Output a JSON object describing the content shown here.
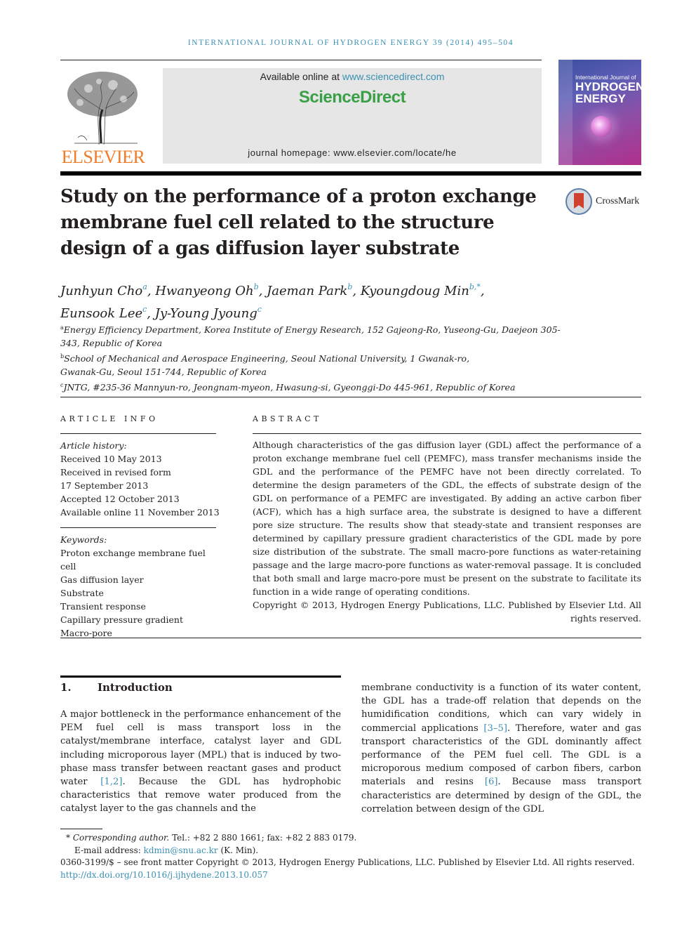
{
  "running_header": "INTERNATIONAL JOURNAL OF HYDROGEN ENERGY 39 (2014) 495–504",
  "publisher": {
    "logo_word": "ELSEVIER",
    "logo_icon": "elsevier-tree-icon"
  },
  "sciencedirect_box": {
    "available_prefix": "Available online at ",
    "available_link": "www.sciencedirect.com",
    "brand": "ScienceDirect",
    "homepage": "journal homepage: www.elsevier.com/locate/he"
  },
  "cover": {
    "line1": "International Journal of",
    "line2": "HYDROGEN",
    "line3": "ENERGY"
  },
  "crossmark": {
    "label": "CrossMark",
    "icon": "crossmark-icon"
  },
  "article": {
    "title": "Study on the performance of a proton exchange membrane fuel cell related to the structure design of a gas diffusion layer substrate",
    "authors": [
      {
        "name": "Junhyun Cho",
        "sup": "a",
        "sep": ", "
      },
      {
        "name": "Hwanyeong Oh",
        "sup": "b",
        "sep": ", "
      },
      {
        "name": "Jaeman Park",
        "sup": "b",
        "sep": ", "
      },
      {
        "name": "Kyoungdoug Min",
        "sup": "b,*",
        "sep": ","
      },
      {
        "name": "Eunsook Lee",
        "sup": "c",
        "sep": ", "
      },
      {
        "name": "Jy-Young Jyoung",
        "sup": "c",
        "sep": ""
      }
    ],
    "affiliations": [
      {
        "sup": "a",
        "text": "Energy Efficiency Department, Korea Institute of Energy Research, 152 Gajeong-Ro, Yuseong-Gu, Daejeon 305-343, Republic of Korea"
      },
      {
        "sup": "b",
        "text": "School of Mechanical and Aerospace Engineering, Seoul National University, 1 Gwanak-ro, Gwanak-Gu, Seoul 151-744, Republic of Korea"
      },
      {
        "sup": "c",
        "text": "JNTG, #235-36 Mannyun-ro, Jeongnam-myeon, Hwasung-si, Gyeonggi-Do 445-961, Republic of Korea"
      }
    ]
  },
  "article_info": {
    "heading": "ARTICLE INFO",
    "history_label": "Article history:",
    "history": [
      "Received 10 May 2013",
      "Received in revised form",
      "17 September 2013",
      "Accepted 12 October 2013",
      "Available online 11 November 2013"
    ],
    "keywords_label": "Keywords:",
    "keywords": [
      "Proton exchange membrane fuel cell",
      "Gas diffusion layer",
      "Substrate",
      "Transient response",
      "Capillary pressure gradient",
      "Macro-pore"
    ]
  },
  "abstract": {
    "heading": "ABSTRACT",
    "text": "Although characteristics of the gas diffusion layer (GDL) affect the performance of a proton exchange membrane fuel cell (PEMFC), mass transfer mechanisms inside the GDL and the performance of the PEMFC have not been directly correlated. To determine the design parameters of the GDL, the effects of substrate design of the GDL on performance of a PEMFC are investigated. By adding an active carbon fiber (ACF), which has a high surface area, the substrate is designed to have a different pore size structure. The results show that steady-state and transient responses are determined by capillary pressure gradient characteristics of the GDL made by pore size distribution of the substrate. The small macro-pore functions as water-retaining passage and the large macro-pore functions as water-removal passage. It is concluded that both small and large macro-pore must be present on the substrate to facilitate its function in a wide range of operating conditions.",
    "copyright": "Copyright © 2013, Hydrogen Energy Publications, LLC. Published by Elsevier Ltd. All rights reserved."
  },
  "introduction": {
    "number": "1.",
    "heading": "Introduction",
    "left_column": [
      {
        "t": "A major bottleneck in the performance enhancement of the PEM fuel cell is mass transport loss in the catalyst/membrane interface, catalyst layer and GDL including microporous layer (MPL) that is induced by two-phase mass transfer between reactant gases and product water "
      },
      {
        "t": "[1,2]",
        "ref": true
      },
      {
        "t": ". Because the GDL has hydrophobic characteristics that remove water produced from the catalyst layer to the gas channels and the"
      }
    ],
    "right_column": [
      {
        "t": "membrane conductivity is a function of its water content, the GDL has a trade-off relation that depends on the humidification conditions, which can vary widely in commercial applications "
      },
      {
        "t": "[3–5]",
        "ref": true
      },
      {
        "t": ". Therefore, water and gas transport characteristics of the GDL dominantly affect performance of the PEM fuel cell. The GDL is a microporous medium composed of carbon fibers, carbon materials and resins "
      },
      {
        "t": "[6]",
        "ref": true
      },
      {
        "t": ". Because mass transport characteristics are determined by design of the GDL, the correlation between design of the GDL"
      }
    ]
  },
  "footnotes": {
    "corresponding_mark": "*",
    "corresponding_label": "Corresponding author.",
    "contact": " Tel.: +82 2 880 1661; fax: +82 2 883 0179.",
    "email_label": "E-mail address: ",
    "email": "kdmin@snu.ac.kr",
    "email_owner": " (K. Min).",
    "issn_line": "0360-3199/$ – see front matter Copyright © 2013, Hydrogen Energy Publications, LLC. Published by Elsevier Ltd. All rights reserved.",
    "doi": "http://dx.doi.org/10.1016/j.ijhydene.2013.10.057"
  }
}
